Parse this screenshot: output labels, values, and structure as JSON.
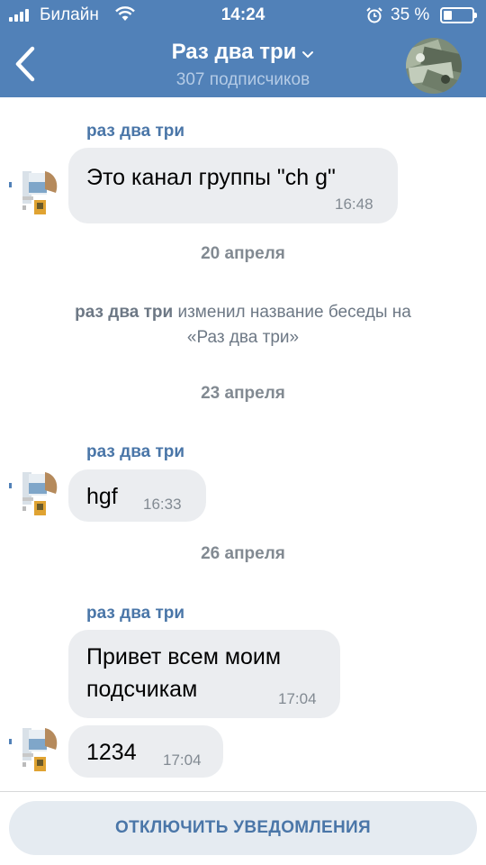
{
  "status_bar": {
    "carrier": "Билайн",
    "time": "14:24",
    "battery_percent": "35 %",
    "battery_level": 0.35
  },
  "header": {
    "title": "Раз два три",
    "subtitle": "307 подписчиков"
  },
  "messages": [
    {
      "sender": "раз два три",
      "text": "Это канал группы \"ch g\"",
      "time": "16:48"
    },
    {
      "sender": "раз два три",
      "text": "hgf",
      "time": "16:33"
    },
    {
      "sender": "раз два три",
      "text_line1": "Привет всем моим",
      "text_line2": "подсчикам",
      "time": "17:04"
    },
    {
      "text": "1234",
      "time": "17:04"
    }
  ],
  "dates": [
    "20 апреля",
    "23 апреля",
    "26 апреля"
  ],
  "system_message": {
    "actor": "раз два три",
    "action": "изменил название беседы на",
    "new_title": "«Раз два три»"
  },
  "footer": {
    "mute_label": "ОТКЛЮЧИТЬ УВЕДОМЛЕНИЯ"
  },
  "colors": {
    "header_bg": "#5181b8",
    "accent": "#4a76a8",
    "bubble_bg": "#ebedf0",
    "button_bg": "#e5ebf1"
  },
  "icons": [
    "signal-icon",
    "wifi-icon",
    "alarm-icon",
    "battery-icon",
    "back-chevron-icon",
    "dropdown-chevron-icon"
  ]
}
